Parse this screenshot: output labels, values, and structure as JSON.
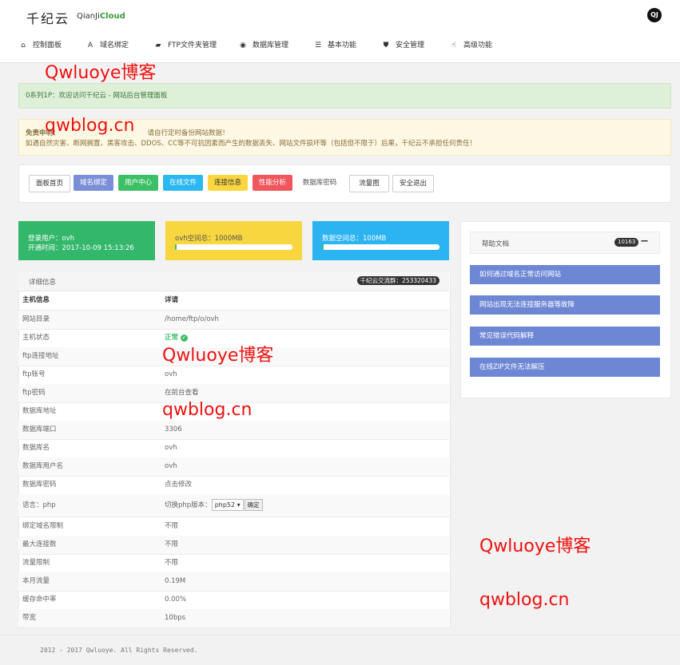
{
  "header": {
    "logo_text": "千纪云",
    "logo_sub_a": "QianJi",
    "logo_sub_b": "Cloud",
    "avatar_text": "QJ"
  },
  "nav": [
    {
      "label": "控制面板",
      "icon": "home-icon",
      "glyph": "⌂"
    },
    {
      "label": "域名绑定",
      "icon": "translate-icon",
      "glyph": "A"
    },
    {
      "label": "FTP文件夹管理",
      "icon": "folder-icon",
      "glyph": "▰"
    },
    {
      "label": "数据库管理",
      "icon": "eye-icon",
      "glyph": "◉"
    },
    {
      "label": "基本功能",
      "icon": "list-icon",
      "glyph": "☰"
    },
    {
      "label": "安全管理",
      "icon": "shield-icon",
      "glyph": "⛊"
    },
    {
      "label": "高级功能",
      "icon": "hand-icon",
      "glyph": "☝"
    }
  ],
  "alerts": {
    "green": "0系列1P：欢迎访问千纪云 - 网站后台管理面板",
    "yellow_line1_a": "免责申明：",
    "yellow_line1_b": "请自行定时备份网站数据！",
    "yellow_line2": "如遇自然灾害、断网搁置、黑客攻击、DDOS、CC等不可抗因素而产生的数据丢失、网站文件损坏等（包括但不限于）后果，千纪云不承担任何责任！"
  },
  "buttons": [
    {
      "label": "面板首页",
      "style": "default"
    },
    {
      "label": "域名绑定",
      "style": "purple"
    },
    {
      "label": "用户中心",
      "style": "green"
    },
    {
      "label": "在线文件",
      "style": "cyan"
    },
    {
      "label": "连接信息",
      "style": "yellow"
    },
    {
      "label": "性能分析",
      "style": "red"
    },
    {
      "label": "数据库密码",
      "style": "plain"
    },
    {
      "label": "流量图",
      "style": "default"
    },
    {
      "label": "安全退出",
      "style": "default"
    }
  ],
  "stats": {
    "user_label": "登录用户：ovh",
    "open_time": "开通时间：2017-10-09 15:13:26",
    "web_space": "ovh空间总：1000MB",
    "web_space_used_fraction": 0.01,
    "db_space": "数据空间总：100MB",
    "db_space_used_fraction": 0.01
  },
  "detail": {
    "title": "详细信息",
    "badge": "千纪云交流群：253320433",
    "col_host": "主机信息",
    "col_detail": "详请",
    "rows": [
      {
        "k": "网站目录",
        "v": "/home/ftp/o/ovh"
      },
      {
        "k": "主机状态",
        "v": "正常"
      },
      {
        "k": "ftp连接地址",
        "v": ""
      },
      {
        "k": "ftp账号",
        "v": "ovh"
      },
      {
        "k": "ftp密码",
        "v": "在前台查看"
      },
      {
        "k": "数据库地址",
        "v": ""
      },
      {
        "k": "数据库端口",
        "v": "3306"
      },
      {
        "k": "数据库名",
        "v": "ovh"
      },
      {
        "k": "数据库用户名",
        "v": "ovh"
      },
      {
        "k": "数据库密码",
        "v": "点击修改"
      },
      {
        "k": "语言：php",
        "v": "切换php版本："
      },
      {
        "k": "绑定域名限制",
        "v": "不限"
      },
      {
        "k": "最大连接数",
        "v": "不限"
      },
      {
        "k": "流量限制",
        "v": "不限"
      },
      {
        "k": "本月流量",
        "v": "0.19M"
      },
      {
        "k": "缓存命中率",
        "v": "0.00%"
      },
      {
        "k": "带宽",
        "v": "10bps"
      }
    ],
    "php_select": "php52",
    "php_confirm": "确定"
  },
  "help": {
    "title": "帮助文档",
    "count": "10163",
    "collapse": "−",
    "items": [
      "如何通过域名正常访问网站",
      "网站出现无法连接服务器等故障",
      "常见错误代码解释",
      "在线ZIP文件无法解压"
    ]
  },
  "footer": {
    "text": "2012 - 2017 Qwluoye. All Rights Reserved."
  },
  "watermarks": [
    "Qwluoye博客",
    "qwblog.cn"
  ],
  "colors": {
    "purple": "#7b8ed8",
    "green_btn": "#3dbf66",
    "cyan": "#2bb7f0",
    "yellow": "#fbd640",
    "red": "#f0575c",
    "stat_green": "#33b76a",
    "stat_yellow": "#f8d63f",
    "stat_blue": "#2bb3f2",
    "help_blue": "#6e87d5"
  }
}
